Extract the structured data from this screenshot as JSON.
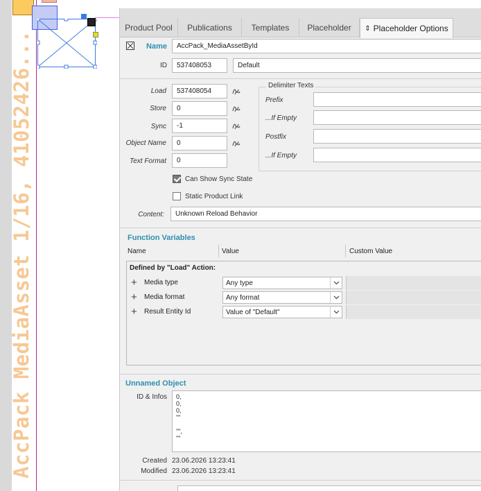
{
  "canvas": {
    "vertical_label": "AccPack MediaAsset 1/16, 41052426..."
  },
  "tabs": [
    {
      "label": "Product Pool",
      "active": false
    },
    {
      "label": "Publications",
      "active": false
    },
    {
      "label": "Templates",
      "active": false
    },
    {
      "label": "Placeholder",
      "active": false
    },
    {
      "label": "Placeholder Options",
      "active": true
    }
  ],
  "header": {
    "name_label": "Name",
    "name_value": "AccPack_MediaAssetById",
    "id_label": "ID",
    "id_value": "537408053",
    "id_extra": "Default"
  },
  "load_section": {
    "load_label": "Load",
    "load_value": "537408054",
    "store_label": "Store",
    "store_value": "0",
    "sync_label": "Sync",
    "sync_value": "-1",
    "object_name_label": "Object Name",
    "object_name_value": "0",
    "text_format_label": "Text Format",
    "text_format_value": "0",
    "can_show_sync_state_label": "Can Show Sync State",
    "can_show_sync_state_checked": true,
    "static_product_link_label": "Static Product Link",
    "static_product_link_checked": false,
    "content_label": "Content:",
    "content_value": "Unknown Reload Behavior"
  },
  "delimiter_texts": {
    "title": "Delimiter Texts",
    "prefix_label": "Prefix",
    "prefix_value": "",
    "if_empty_label_1": "...If Empty",
    "if_empty_value_1": "",
    "postfix_label": "Postfix",
    "postfix_value": "",
    "if_empty_label_2": "...If Empty",
    "if_empty_value_2": ""
  },
  "function_variables": {
    "title": "Function Variables",
    "columns": [
      "Name",
      "Value",
      "Custom Value"
    ],
    "group_title": "Defined by \"Load\" Action:",
    "rows": [
      {
        "name": "Media type",
        "value": "Any type"
      },
      {
        "name": "Media format",
        "value": "Any format"
      },
      {
        "name": "Result Entity Id",
        "value": "Value of \"Default\""
      }
    ]
  },
  "unnamed_object": {
    "title": "Unnamed Object",
    "id_infos_label": "ID & Infos",
    "id_infos_lines": [
      "0,",
      "0,",
      "0,",
      "\"\"",
      "",
      "\"\",",
      "\"\""
    ],
    "created_label": "Created",
    "created_value": "23.06.2026 13:23:41",
    "modified_label": "Modified",
    "modified_value": "23.06.2026 13:23:41"
  },
  "colors": {
    "accent": "#2f8fae",
    "vertical_label": "#f6c894",
    "page_edge": "#b02a8a"
  }
}
